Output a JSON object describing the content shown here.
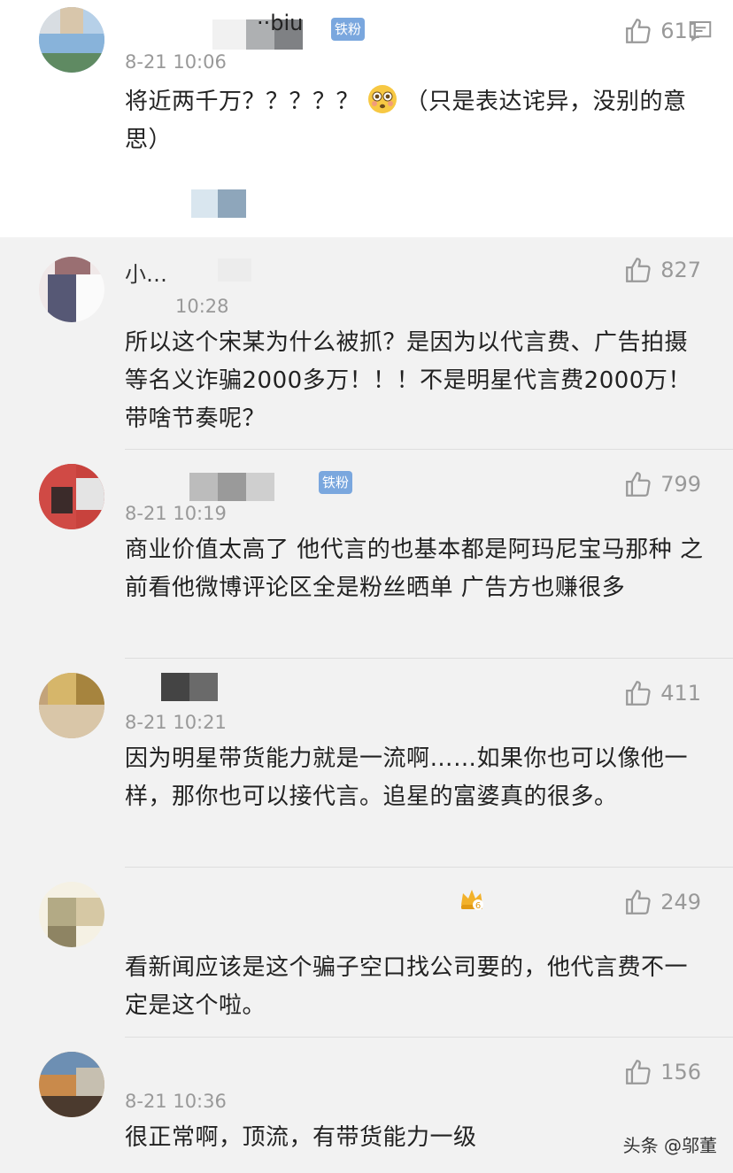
{
  "comments": [
    {
      "username": "··biu",
      "badge": "铁粉",
      "likes": "611",
      "time": "8-21 10:06",
      "text_before_emoji": "将近两千万？？？？？",
      "text_after_emoji": "（只是表达诧异，没别的意思）",
      "emoji": "flushed-face-emoji"
    },
    {
      "username": "小…",
      "likes": "827",
      "time": "10:28",
      "text": "所以这个宋某为什么被抓？是因为以代言费、广告拍摄等名义诈骗2000多万！！！不是明星代言费2000万！带啥节奏呢？"
    },
    {
      "username": "",
      "badge": "铁粉",
      "likes": "799",
      "time": "8-21 10:19",
      "text": "商业价值太高了 他代言的也基本都是阿玛尼宝马那种 之前看他微博评论区全是粉丝晒单 广告方也赚很多"
    },
    {
      "username": "",
      "likes": "411",
      "time": "8-21 10:21",
      "text": "因为明星带货能力就是一流啊……如果你也可以像他一样，那你也可以接代言。追星的富婆真的很多。"
    },
    {
      "username": "",
      "likes": "249",
      "vip_level": "6",
      "text": "看新闻应该是这个骗子空口找公司要的，他代言费不一定是这个啦。"
    },
    {
      "username": "",
      "likes": "156",
      "time": "8-21 10:36",
      "text": "很正常啊，顶流，有带货能力一级"
    }
  ],
  "watermark": "头条 @邬董",
  "colors": {
    "accent_badge": "#7aa7de",
    "muted": "#999999"
  }
}
